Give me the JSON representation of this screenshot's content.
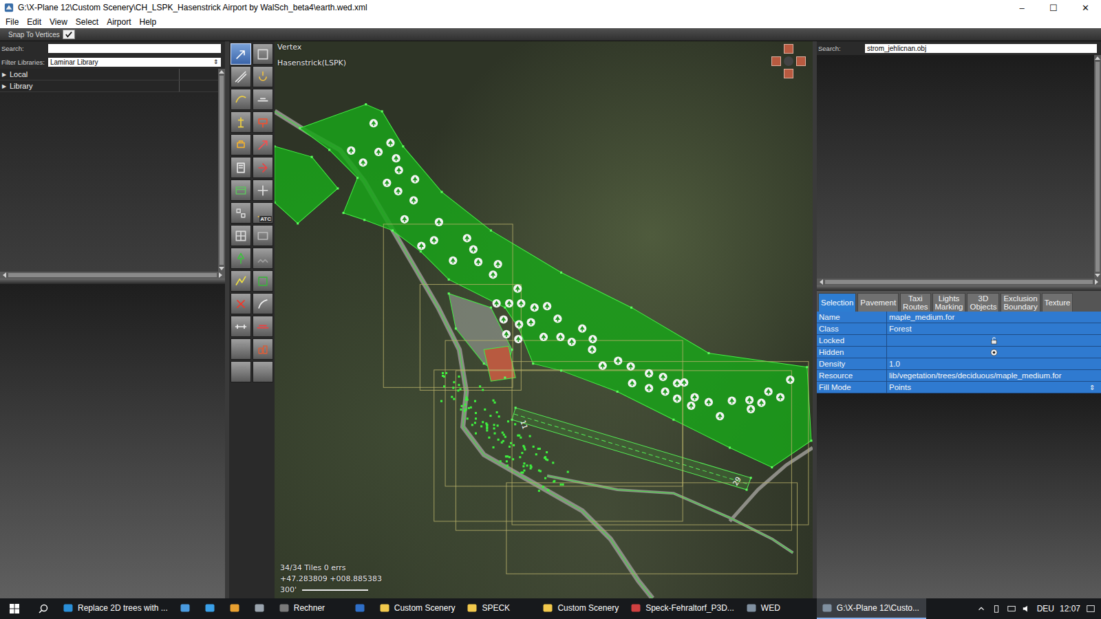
{
  "window": {
    "title": "G:\\X-Plane 12\\Custom Scenery\\CH_LSPK_Hasenstrick Airport by WalSch_beta4\\earth.wed.xml",
    "controls": [
      "–",
      "☐",
      "✕"
    ]
  },
  "menu": [
    {
      "label": "File"
    },
    {
      "label": "Edit"
    },
    {
      "label": "View"
    },
    {
      "label": "Select"
    },
    {
      "label": "Airport"
    },
    {
      "label": "Help"
    }
  ],
  "toolbar": {
    "label": "Snap To Vertices",
    "checked": true
  },
  "library": {
    "search_label": "Search:",
    "search_value": "",
    "filter_label": "Filter Libraries:",
    "filter_value": "Laminar Library",
    "filter_arrow": "⇕",
    "items": [
      {
        "label": "Local",
        "arrow": "▶",
        "expanded": false
      },
      {
        "label": "Library",
        "arrow": "▶",
        "expanded": false
      }
    ]
  },
  "tools": [
    {
      "selected": true,
      "label": ""
    },
    {
      "selected": false,
      "label": ""
    },
    {
      "selected": false,
      "label": ""
    },
    {
      "selected": false,
      "label": ""
    },
    {
      "selected": false,
      "label": ""
    },
    {
      "selected": false,
      "label": ""
    },
    {
      "selected": false,
      "label": ""
    },
    {
      "selected": false,
      "label": ""
    },
    {
      "selected": false,
      "label": ""
    },
    {
      "selected": false,
      "label": ""
    },
    {
      "selected": false,
      "label": ""
    },
    {
      "selected": false,
      "label": ""
    },
    {
      "selected": false,
      "label": ""
    },
    {
      "selected": false,
      "label": ""
    },
    {
      "selected": false,
      "label": ""
    },
    {
      "selected": false,
      "label": "ATC"
    },
    {
      "selected": false,
      "label": ""
    },
    {
      "selected": false,
      "label": ""
    },
    {
      "selected": false,
      "label": ""
    },
    {
      "selected": false,
      "label": ""
    },
    {
      "selected": false,
      "label": ""
    },
    {
      "selected": false,
      "label": ""
    },
    {
      "selected": false,
      "label": ""
    },
    {
      "selected": false,
      "label": ""
    },
    {
      "selected": false,
      "label": ""
    },
    {
      "selected": false,
      "label": ""
    },
    {
      "selected": false,
      "label": ""
    },
    {
      "selected": false,
      "label": ""
    },
    {
      "selected": false,
      "label": ""
    },
    {
      "selected": false,
      "label": ""
    }
  ],
  "map": {
    "mode": "Vertex",
    "airport": "Hasenstrick(LSPK)",
    "tiles": "34/34 Tiles 0 errs",
    "coords": "+47.283809 +008.885383",
    "scale": "300'",
    "runway_ends": [
      "11",
      "29"
    ]
  },
  "resources": {
    "search_label": "Search:",
    "search_value": "strom_jehlicnan.obj"
  },
  "tabs": [
    {
      "label": "Selection",
      "selected": true
    },
    {
      "label": "Pavement",
      "selected": false
    },
    {
      "label": "Taxi Routes",
      "selected": false
    },
    {
      "label": "Lights Marking",
      "selected": false
    },
    {
      "label": "3D Objects",
      "selected": false
    },
    {
      "label": "Exclusion Boundary",
      "selected": false
    },
    {
      "label": "Texture",
      "selected": false
    }
  ],
  "properties": [
    {
      "label": "Name",
      "kind": "text",
      "value": "maple_medium.for",
      "selected": true
    },
    {
      "label": "Class",
      "kind": "text",
      "value": "Forest",
      "selected": true
    },
    {
      "label": "Locked",
      "kind": "lock",
      "value": "",
      "checked": false,
      "selected": true
    },
    {
      "label": "Hidden",
      "kind": "eye",
      "value": "",
      "checked": false,
      "selected": true
    },
    {
      "label": "Density",
      "kind": "text",
      "value": "1.0",
      "selected": true
    },
    {
      "label": "Resource",
      "kind": "text",
      "value": "lib/vegetation/trees/deciduous/maple_medium.for",
      "selected": true
    },
    {
      "label": "Fill Mode",
      "kind": "enum",
      "value": "Points",
      "arrow": "⇕",
      "selected": true
    }
  ],
  "taskbar": {
    "items": [
      {
        "label": "Replace 2D trees with ...",
        "active": false,
        "color": "#2a8fd8"
      },
      {
        "label": "",
        "active": false,
        "color": "#4a9be0"
      },
      {
        "label": "",
        "active": false,
        "color": "#3aa0e8"
      },
      {
        "label": "",
        "active": false,
        "color": "#e8a030"
      },
      {
        "label": "",
        "active": false,
        "color": "#9aa4ae"
      },
      {
        "label": "Rechner",
        "active": false,
        "color": "#7a7a7a"
      },
      {
        "label": "",
        "active": false,
        "color": "#2f6fc8"
      },
      {
        "label": "Custom Scenery",
        "active": false,
        "color": "#f2c94c"
      },
      {
        "label": "SPECK",
        "active": false,
        "color": "#f2c94c"
      },
      {
        "label": "Custom Scenery",
        "active": false,
        "color": "#f2c94c"
      },
      {
        "label": "Speck-Fehraltorf_P3D...",
        "active": false,
        "color": "#d04040"
      },
      {
        "label": "WED",
        "active": false,
        "color": "#8090a0"
      },
      {
        "label": "G:\\X-Plane 12\\Custo...",
        "active": true,
        "color": "#8090a0"
      }
    ],
    "language": "DEU",
    "time": "12:07"
  }
}
